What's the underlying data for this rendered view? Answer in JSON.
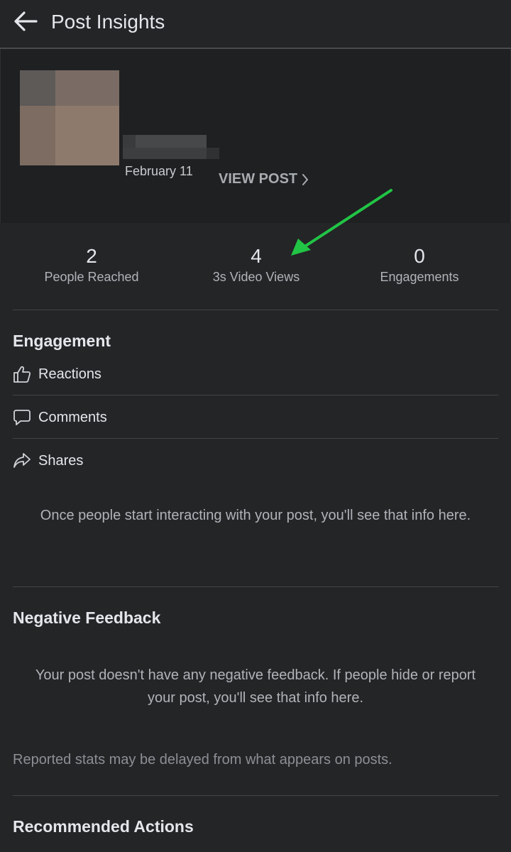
{
  "header": {
    "title": "Post Insights",
    "back_icon": "arrow-left-icon"
  },
  "post": {
    "date": "February 11",
    "view_post_label": "VIEW POST"
  },
  "stats": [
    {
      "value": "2",
      "label": "People Reached"
    },
    {
      "value": "4",
      "label": "3s Video Views"
    },
    {
      "value": "0",
      "label": "Engagements"
    }
  ],
  "annotation": {
    "arrow_color": "#21c445"
  },
  "engagement": {
    "title": "Engagement",
    "items": [
      {
        "label": "Reactions",
        "icon": "thumbs-up-icon"
      },
      {
        "label": "Comments",
        "icon": "comment-icon"
      },
      {
        "label": "Shares",
        "icon": "share-icon"
      }
    ],
    "empty_message": "Once people start interacting with your post, you'll see that info here."
  },
  "negative_feedback": {
    "title": "Negative Feedback",
    "message": "Your post doesn't have any negative feedback. If people hide or report your post, you'll see that info here.",
    "note": "Reported stats may be delayed from what appears on posts."
  },
  "recommended_actions": {
    "title": "Recommended Actions"
  },
  "colors": {
    "background": "#242527",
    "card": "#1f2022",
    "text": "#e4e6eb",
    "muted": "#b0b3b8"
  }
}
